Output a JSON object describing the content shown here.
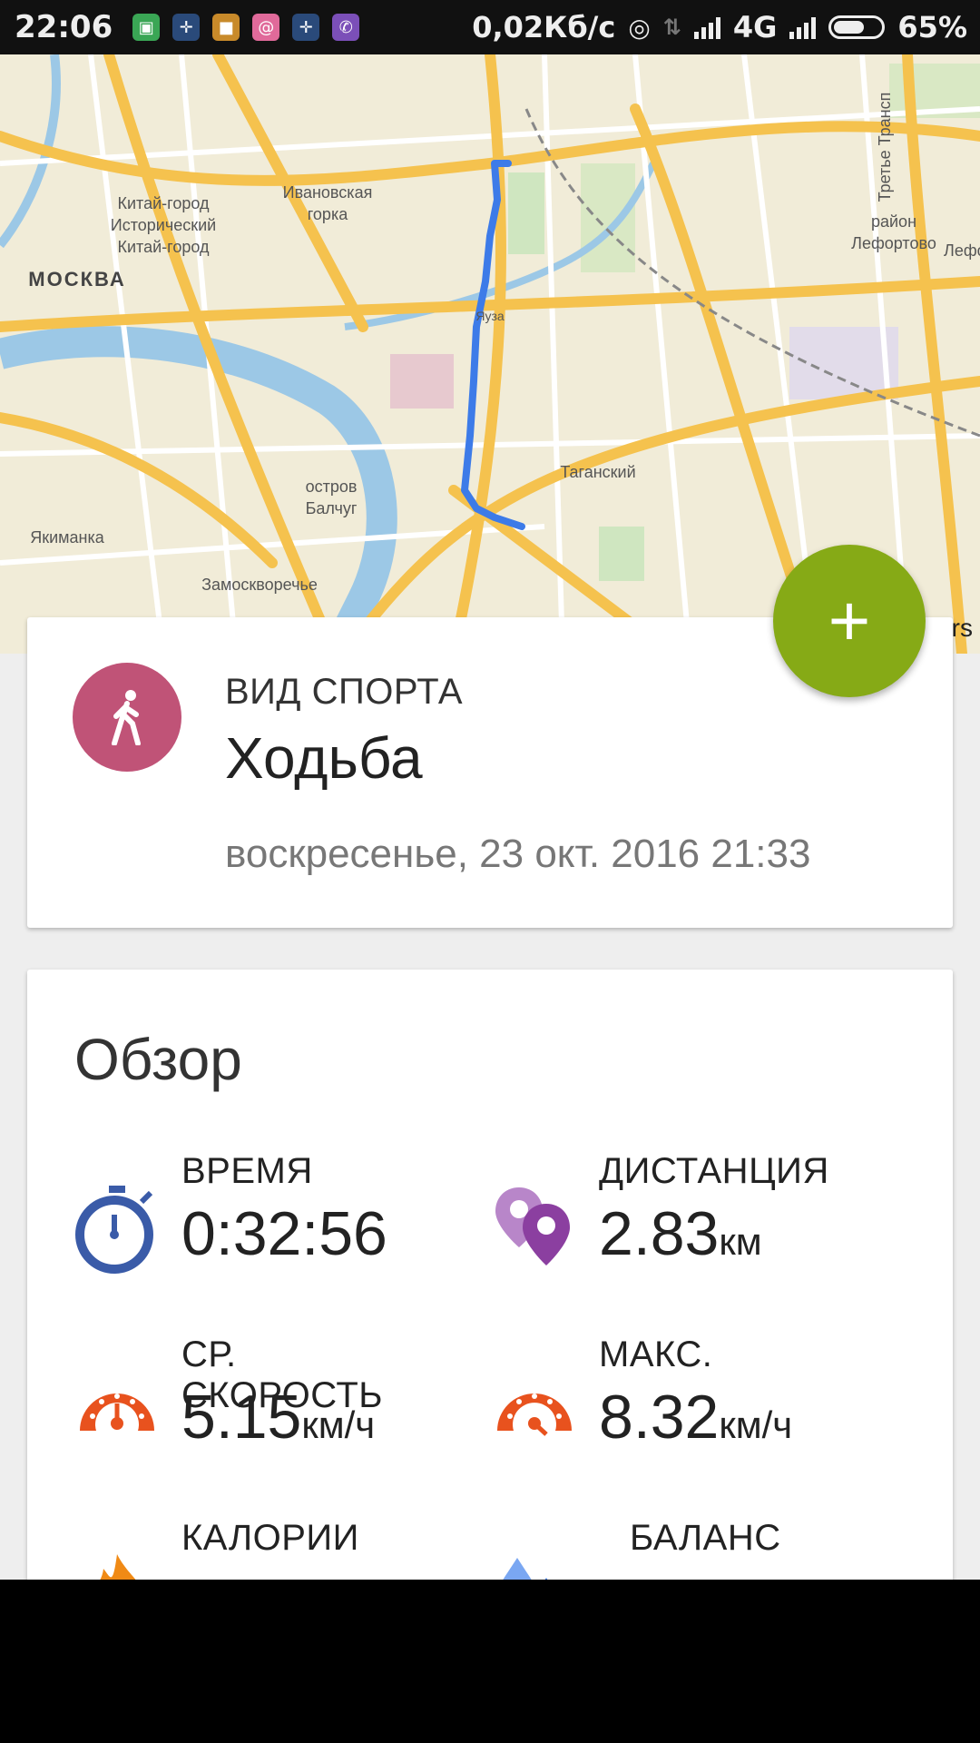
{
  "status_bar": {
    "time": "22:06",
    "net_speed": "0,02Кб/с",
    "network_type": "4G",
    "battery": "65%",
    "battery_level": 0.65,
    "notification_icons": [
      "lock-icon",
      "satellite-icon",
      "app-icon",
      "mail-icon",
      "satellite-icon",
      "viber-icon"
    ]
  },
  "map": {
    "labels": {
      "kitay_gorod": "Китай-город Исторический Китай-город",
      "ivanovskaya": "Ивановская горка",
      "moskva": "МОСКВА",
      "lefortovo": "район Лефортово",
      "taganskiy": "Таганский",
      "ostrov": "остров Балчуг",
      "yakimanka": "Якиманка",
      "zamoskvorechye": "Замоскворечье",
      "tretye": "Третье Трансп",
      "lefo_edge": "Лефо",
      "yauza": "Яуза"
    },
    "attribution": "rs",
    "route_color": "#3d7be8"
  },
  "sport": {
    "label": "ВИД СПОРТА",
    "value": "Ходьба",
    "datetime": "воскресенье, 23 окт. 2016 21:33",
    "icon": "walking-person-icon",
    "color": "#c05377"
  },
  "fab": {
    "label": "+",
    "color": "#86aa16"
  },
  "overview": {
    "title": "Обзор",
    "stats": {
      "time": {
        "label": "ВРЕМЯ",
        "value": "0:32:56",
        "unit": "",
        "icon": "stopwatch-icon",
        "color": "#3a5ba8"
      },
      "distance": {
        "label": "ДИСТАНЦИЯ",
        "value": "2.83",
        "unit": "км",
        "icon": "map-pins-icon",
        "color": "#8b3fa0"
      },
      "avg_speed": {
        "label": "СР. СКОРОСТЬ",
        "value": "5.15",
        "unit": "км/ч",
        "icon": "speedometer-icon",
        "color": "#e8521e"
      },
      "max_speed": {
        "label": "МАКС.",
        "value": "8.32",
        "unit": "км/ч",
        "icon": "speedometer-icon",
        "color": "#e8521e"
      },
      "calories": {
        "label": "КАЛОРИИ",
        "icon": "flame-icon",
        "color": "#f08a15"
      },
      "balance": {
        "label": "БАЛАНС",
        "icon": "water-drops-icon",
        "color": "#4a86e8"
      }
    }
  }
}
